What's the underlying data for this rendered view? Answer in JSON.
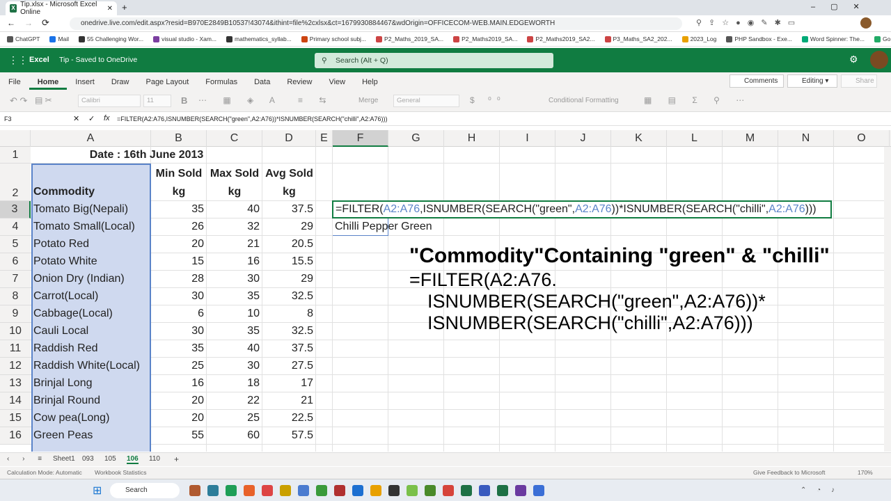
{
  "browser": {
    "tab_title": "Tip.xlsx - Microsoft Excel Online",
    "url": "onedrive.live.com/edit.aspx?resid=B970E2849B10537!43074&ithint=file%2cxlsx&ct=1679930884467&wdOrigin=OFFICECOM-WEB.MAIN.EDGEWORTH",
    "bookmarks": [
      "ChatGPT",
      "Mail",
      "55 Challenging Wor...",
      "visual studio - Xam...",
      "mathematics_syllab...",
      "Primary school subj...",
      "P2_Maths_2019_SA...",
      "P2_Maths2019_SA...",
      "P2_Maths2019_SA2...",
      "P3_Maths_SA2_202...",
      "2023_Log",
      "PHP Sandbox - Exe...",
      "Word Spinner: The...",
      "Go PG Old"
    ]
  },
  "excel": {
    "app_name": "Excel",
    "file_status": "Tip  -  Saved to OneDrive",
    "search_placeholder": "Search (Alt + Q)",
    "ribbon_tabs": [
      "File",
      "Home",
      "Insert",
      "Draw",
      "Page Layout",
      "Formulas",
      "Data",
      "Review",
      "View",
      "Help"
    ],
    "comments_label": "Comments",
    "editing_label": "Editing",
    "share_label": "Share",
    "font_name": "Calibri",
    "font_size": "11",
    "number_format": "General",
    "merge_label": "Merge",
    "conditional_formatting": "Conditional Formatting",
    "name_box": "F3",
    "formula": "=FILTER(A2:A76,ISNUMBER(SEARCH(\"green\",A2:A76))*ISNUMBER(SEARCH(\"chilli\",A2:A76)))"
  },
  "grid": {
    "columns": [
      "A",
      "B",
      "C",
      "D",
      "E",
      "F",
      "G",
      "H",
      "I",
      "J",
      "K",
      "L",
      "M",
      "N",
      "O"
    ],
    "title": "Date : 16th June 2013",
    "headers": {
      "a": "Commodity",
      "b1": "Min Sold",
      "b2": "kg",
      "c1": "Max Sold",
      "c2": "kg",
      "d1": "Avg Sold",
      "d2": "kg"
    },
    "rows": [
      {
        "n": "3",
        "a": "Tomato Big(Nepali)",
        "b": "35",
        "c": "40",
        "d": "37.5"
      },
      {
        "n": "4",
        "a": "Tomato Small(Local)",
        "b": "26",
        "c": "32",
        "d": "29"
      },
      {
        "n": "5",
        "a": "Potato Red",
        "b": "20",
        "c": "21",
        "d": "20.5"
      },
      {
        "n": "6",
        "a": "Potato White",
        "b": "15",
        "c": "16",
        "d": "15.5"
      },
      {
        "n": "7",
        "a": "Onion Dry (Indian)",
        "b": "28",
        "c": "30",
        "d": "29"
      },
      {
        "n": "8",
        "a": "Carrot(Local)",
        "b": "30",
        "c": "35",
        "d": "32.5"
      },
      {
        "n": "9",
        "a": "Cabbage(Local)",
        "b": "6",
        "c": "10",
        "d": "8"
      },
      {
        "n": "10",
        "a": "Cauli Local",
        "b": "30",
        "c": "35",
        "d": "32.5"
      },
      {
        "n": "11",
        "a": "Raddish Red",
        "b": "35",
        "c": "40",
        "d": "37.5"
      },
      {
        "n": "12",
        "a": "Raddish White(Local)",
        "b": "25",
        "c": "30",
        "d": "27.5"
      },
      {
        "n": "13",
        "a": "Brinjal Long",
        "b": "16",
        "c": "18",
        "d": "17"
      },
      {
        "n": "14",
        "a": "Brinjal Round",
        "b": "20",
        "c": "22",
        "d": "21"
      },
      {
        "n": "15",
        "a": "Cow pea(Long)",
        "b": "20",
        "c": "25",
        "d": "22.5"
      },
      {
        "n": "16",
        "a": "Green Peas",
        "b": "55",
        "c": "60",
        "d": "57.5"
      }
    ],
    "formula_parts": [
      "=FILTER(",
      "A2:A76",
      ",ISNUMBER(SEARCH(\"green\",",
      "A2:A76",
      "))*ISNUMBER(SEARCH(\"chilli\",",
      "A2:A76",
      ")))"
    ],
    "result_f4": "Chilli Pepper Green"
  },
  "annotation": {
    "title": "\"Commodity\"Containing \"green\" & \"chilli\"",
    "line1": "=FILTER(A2:A76.",
    "line2": "ISNUMBER(SEARCH(\"green\",A2:A76))*",
    "line3": "ISNUMBER(SEARCH(\"chilli\",A2:A76)))"
  },
  "sheets": {
    "tabs": [
      "Sheet1",
      "093",
      "105",
      "106",
      "110"
    ],
    "active": "106"
  },
  "status": {
    "calc_mode": "Calculation Mode: Automatic",
    "stats": "Workbook Statistics",
    "feedback": "Give Feedback to Microsoft",
    "zoom": "170%"
  },
  "taskbar": {
    "search_label": "Search"
  }
}
